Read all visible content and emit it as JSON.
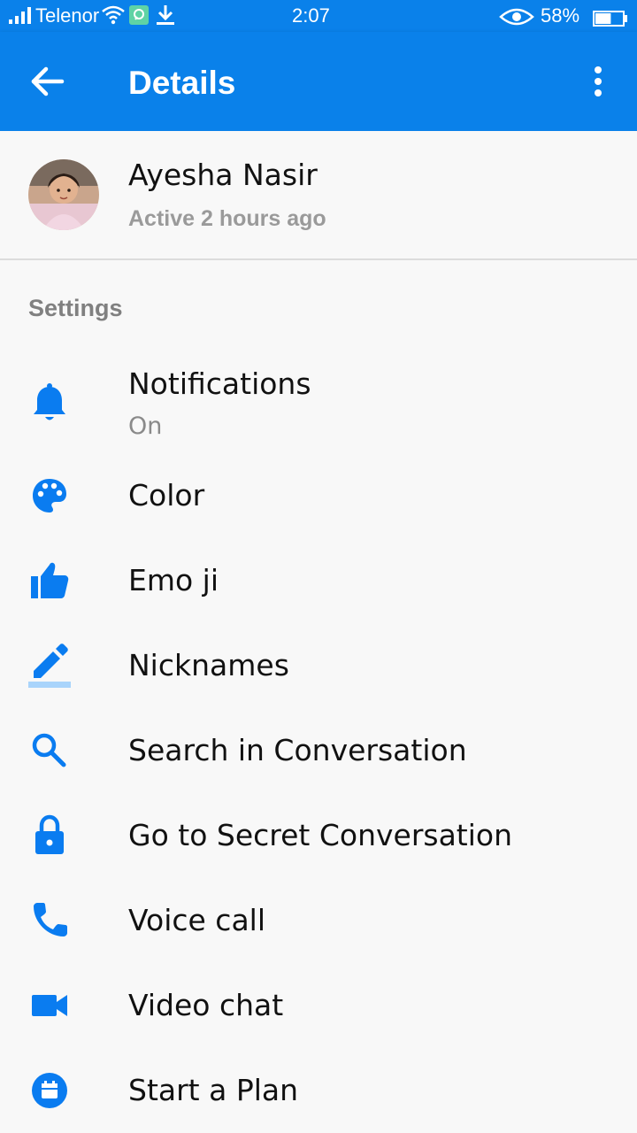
{
  "colors": {
    "accent": "#0a81ea",
    "icon": "#0a7cf0",
    "background": "#f8f8f8",
    "text_primary": "#111111",
    "text_secondary": "#9a9a9a"
  },
  "status_bar": {
    "carrier": "Telenor",
    "time": "2:07",
    "battery": "58%",
    "battery_level": 0.58,
    "icons": [
      "signal-icon",
      "wifi-icon",
      "app-notification-icon",
      "download-icon",
      "eye-icon",
      "battery-icon"
    ]
  },
  "app_bar": {
    "title": "Details",
    "back_icon": "arrow-back-icon",
    "menu_icon": "more-vertical-icon"
  },
  "profile": {
    "name": "Ayesha Nasir",
    "status": "Active 2 hours ago"
  },
  "settings": {
    "header": "Settings",
    "items": [
      {
        "label": "Notifications",
        "sublabel": "On",
        "icon": "bell-icon"
      },
      {
        "label": "Color",
        "icon": "palette-icon"
      },
      {
        "label": "Emo ji",
        "icon": "thumbs-up-icon"
      },
      {
        "label": "Nicknames",
        "icon": "pencil-icon"
      },
      {
        "label": "Search in Conversation",
        "icon": "search-icon"
      },
      {
        "label": "Go to Secret Conversation",
        "icon": "lock-icon"
      },
      {
        "label": "Voice call",
        "icon": "phone-icon"
      },
      {
        "label": "Video chat",
        "icon": "video-camera-icon"
      },
      {
        "label": "Start a Plan",
        "icon": "calendar-icon"
      }
    ]
  }
}
